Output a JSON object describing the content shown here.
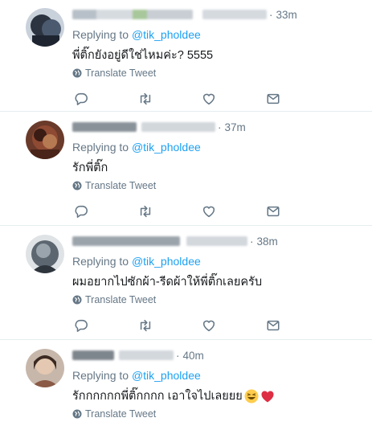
{
  "tweets": [
    {
      "time": "33m",
      "replying_prefix": "Replying to",
      "replying_handle": "@tik_pholdee",
      "text": "พี่ติ๊กยังอยู่ดีใช่ไหมค่ะ? 5555",
      "translate_label": "Translate Tweet"
    },
    {
      "time": "37m",
      "replying_prefix": "Replying to",
      "replying_handle": "@tik_pholdee",
      "text": "รักพี่ติ๊ก",
      "translate_label": "Translate Tweet"
    },
    {
      "time": "38m",
      "replying_prefix": "Replying to",
      "replying_handle": "@tik_pholdee",
      "text": "ผมอยากไปซักผ้า-รีดผ้าให้พี่ติ๊กเลยครับ",
      "translate_label": "Translate Tweet"
    },
    {
      "time": "40m",
      "replying_prefix": "Replying to",
      "replying_handle": "@tik_pholdee",
      "text": "รักกกกกกพี่ติ๊กกกก เอาใจไปเลยยย",
      "emojis": [
        "grinning-squinting-face",
        "red-heart"
      ],
      "translate_label": "Translate Tweet"
    }
  ],
  "colors": {
    "link": "#1da1f2",
    "secondary_text": "#657786",
    "divider": "#e6ecf0",
    "heart": "#e0245e"
  }
}
